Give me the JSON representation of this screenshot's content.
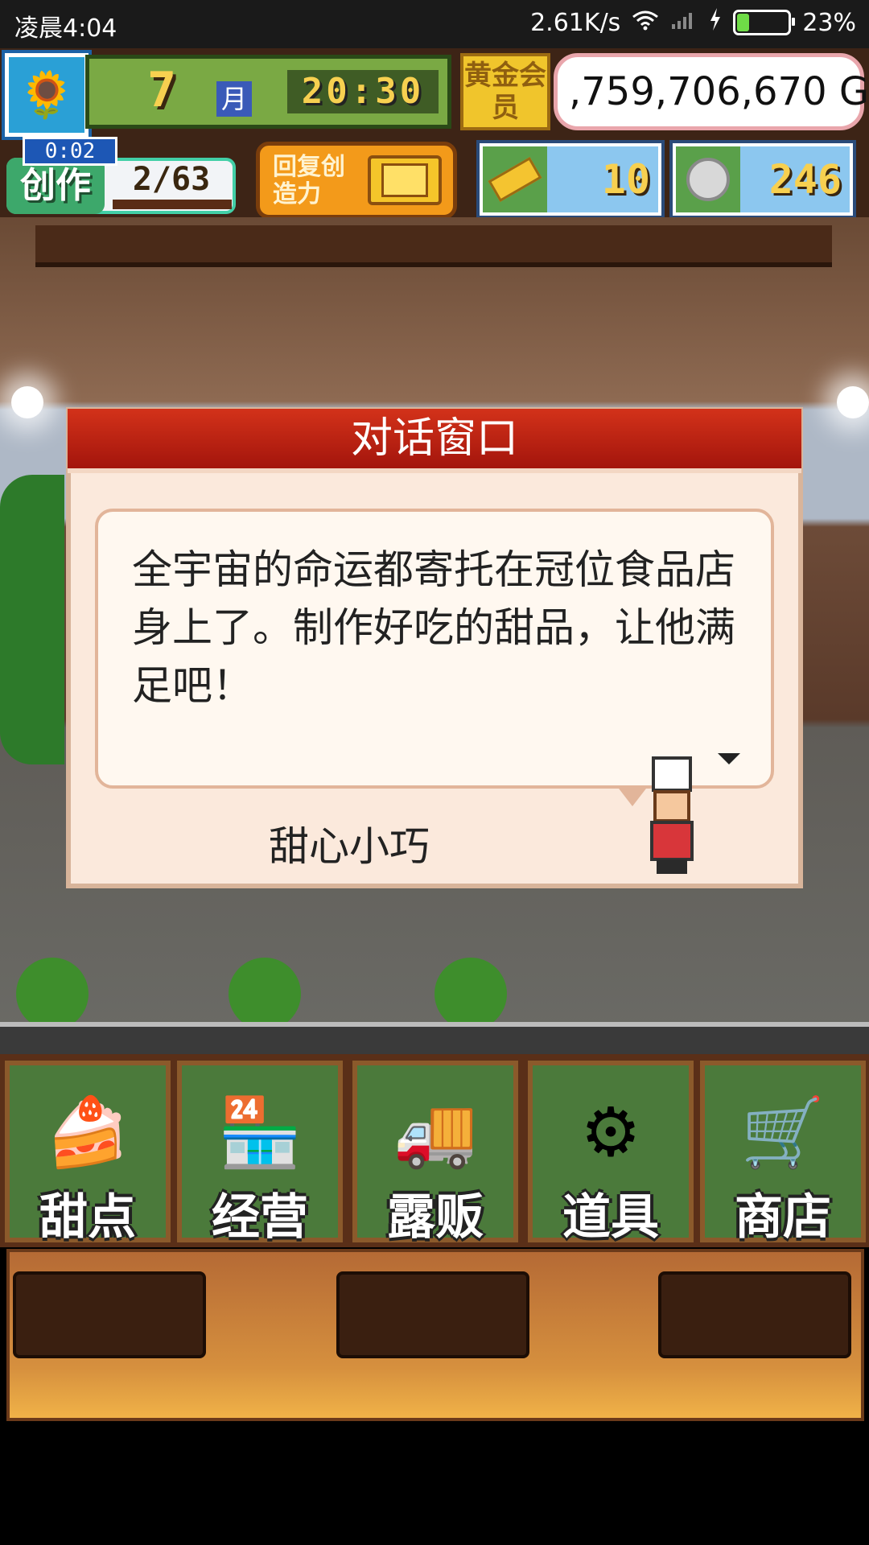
{
  "status_bar": {
    "time": "凌晨4:04",
    "network_speed": "2.61K/s",
    "battery": "23%",
    "battery_level": 0.23,
    "icons": [
      "wifi-icon",
      "signal-icon",
      "charging-icon",
      "battery-icon"
    ]
  },
  "hud": {
    "month_number": "7",
    "month_label": "月",
    "clock": "20:30",
    "gold_member": "黄金会员",
    "money": ",759,706,670 G",
    "create_timer": "0:02",
    "create_label": "创作",
    "create_count": "2/63",
    "recover_button": "回复创造力",
    "gold_bars": "10",
    "coins": "246",
    "icons": {
      "avatar": "sunflower-icon",
      "gold_bar": "gold-bar-icon",
      "coin": "coin-icon",
      "tv": "tv-icon"
    }
  },
  "dialog": {
    "title": "对话窗口",
    "message": "全宇宙的命运都寄托在冠位食品店身上了。制作好吃的甜品，让他满足吧！",
    "speaker": "甜心小巧"
  },
  "menu": {
    "items": [
      {
        "label": "甜点",
        "icon": "cake-icon"
      },
      {
        "label": "经营",
        "icon": "shop-icon"
      },
      {
        "label": "露贩",
        "icon": "food-truck-icon"
      },
      {
        "label": "道具",
        "icon": "items-bag-icon"
      },
      {
        "label": "商店",
        "icon": "cart-icon"
      }
    ]
  },
  "colors": {
    "dialog_title_bg": "#c0261a",
    "menu_button_bg": "#4b7a3b",
    "gold": "#f7d050"
  }
}
